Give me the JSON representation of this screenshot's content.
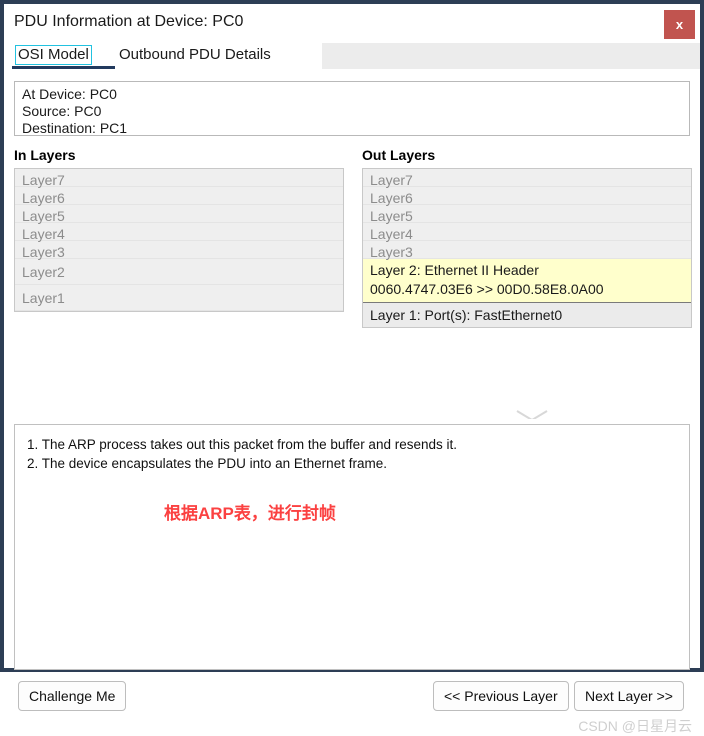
{
  "window": {
    "title": "PDU Information at Device: PC0",
    "close_label": "x",
    "frame_color": "#2d3e55",
    "close_color": "#c1544f"
  },
  "tabs": [
    {
      "label": "OSI Model",
      "selected": true
    },
    {
      "label": "Outbound PDU Details",
      "selected": false
    }
  ],
  "info": {
    "at_device": "At Device: PC0",
    "source": "Source: PC0",
    "destination": "Destination: PC1"
  },
  "in_layers": {
    "header": "In Layers",
    "rows": [
      {
        "label": "Layer7",
        "state": "empty"
      },
      {
        "label": "Layer6",
        "state": "empty"
      },
      {
        "label": "Layer5",
        "state": "empty"
      },
      {
        "label": "Layer4",
        "state": "empty"
      },
      {
        "label": "Layer3",
        "state": "empty"
      },
      {
        "label": "Layer2",
        "state": "tall"
      },
      {
        "label": "Layer1",
        "state": "tall"
      }
    ]
  },
  "out_layers": {
    "header": "Out Layers",
    "rows": [
      {
        "label": "Layer7",
        "state": "empty"
      },
      {
        "label": "Layer6",
        "state": "empty"
      },
      {
        "label": "Layer5",
        "state": "empty"
      },
      {
        "label": "Layer4",
        "state": "empty"
      },
      {
        "label": "Layer3",
        "state": "empty"
      },
      {
        "label": "Layer 2: Ethernet II Header",
        "sub": "0060.4747.03E6 >> 00D0.58E8.0A00",
        "state": "active"
      },
      {
        "label": "Layer 1: Port(s): FastEthernet0",
        "state": "current"
      }
    ],
    "highlight_color": "#ffffcc"
  },
  "description": {
    "line1": "1. The ARP process takes out this packet from the buffer and resends it.",
    "line2": "2. The device encapsulates the PDU into an Ethernet frame.",
    "annotation": "根据ARP表，进行封帧",
    "annotation_color": "#fb4141"
  },
  "footer": {
    "challenge_label": "Challenge Me",
    "previous_label": "<< Previous Layer",
    "next_label": "Next Layer >>",
    "watermark": "CSDN @日星月云"
  }
}
